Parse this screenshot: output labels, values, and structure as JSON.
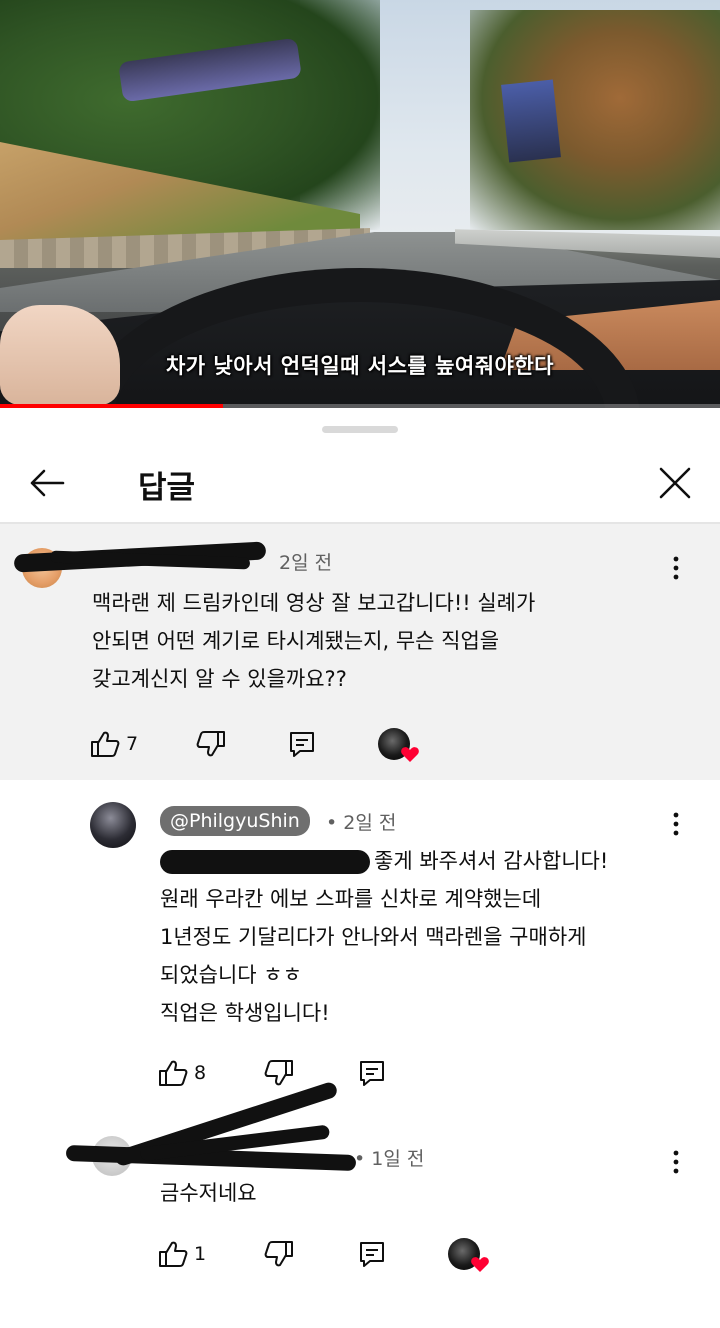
{
  "video": {
    "subtitle": "차가 낮아서 언덕일때 서스를 높여줘야한다",
    "progress_fraction": 0.31
  },
  "sheet": {
    "title": "답글"
  },
  "parent_comment": {
    "time": "2일 전",
    "text": "맥라랜 제 드림카인데 영상 잘 보고갑니다!! 실례가\n안되면 어떤 계기로 타시계됐는지, 무슨 직업을\n갖고계신지 알 수 있을까요??",
    "like_count": "7",
    "hearted": true
  },
  "replies": [
    {
      "handle": "@PhilgyuShin",
      "time": "2일 전",
      "text_first_line_visible": "좋게 봐주셔서 감사합니다!",
      "text": "원래 우라칸 에보 스파를 신차로 계약했는데\n1년정도 기달리다가 안나와서 맥라렌을 구매하게\n되었습니다 ㅎㅎ\n직업은 학생입니다!",
      "like_count": "8"
    },
    {
      "time": "1일 전",
      "text": "금수저네요",
      "like_count": "1",
      "hearted": true
    }
  ],
  "colors": {
    "heart": "#ff0033",
    "progress": "#ff0000",
    "pill": "#6f6f6f"
  }
}
